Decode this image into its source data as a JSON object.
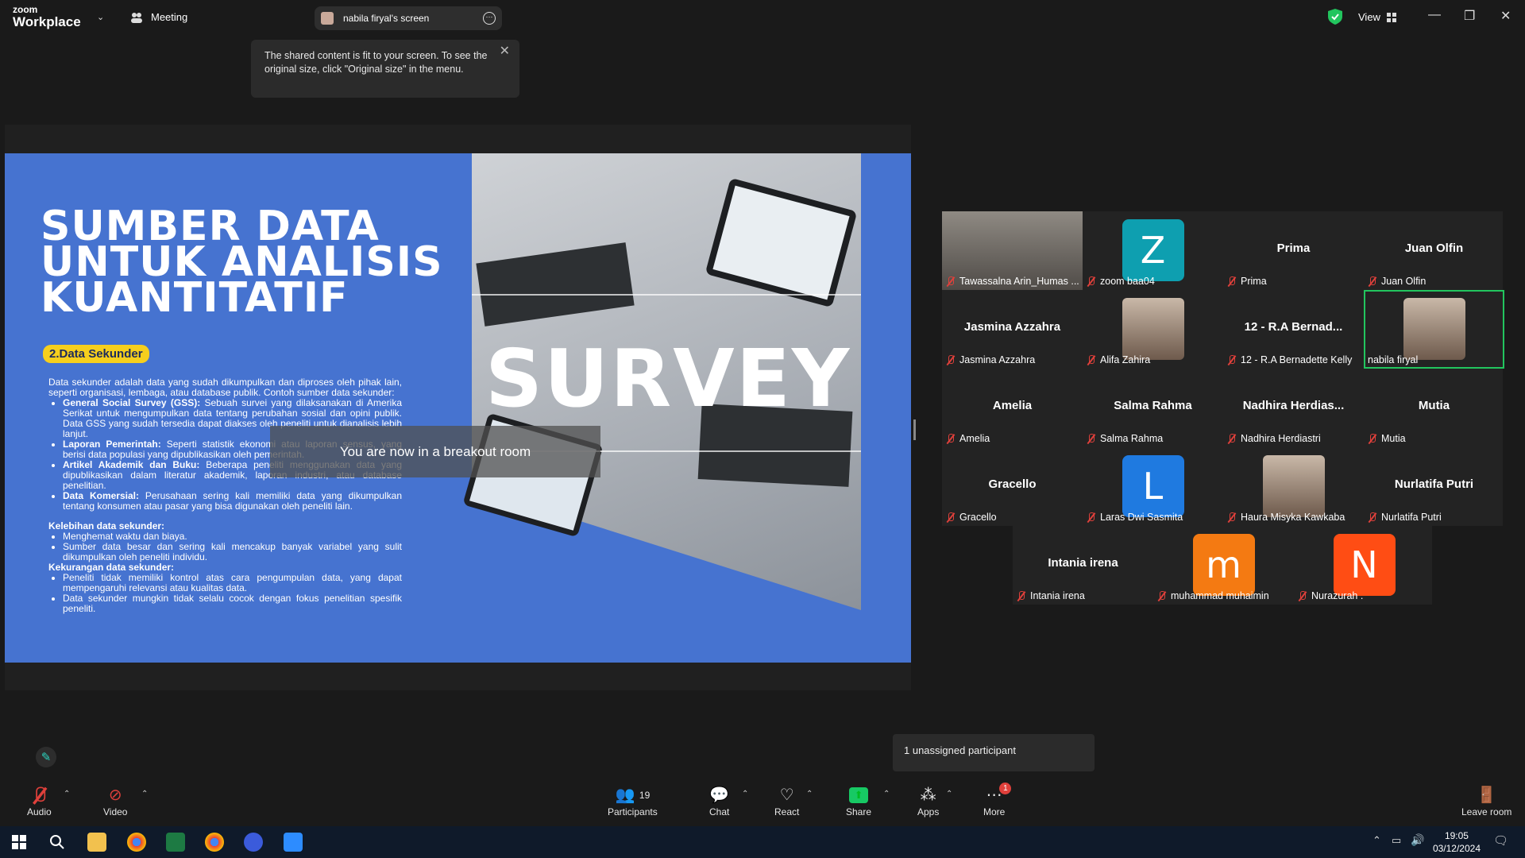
{
  "app": {
    "brand_top": "zoom",
    "brand_bottom": "Workplace",
    "meeting_label": "Meeting",
    "screen_owner": "nabila firyal's screen",
    "view_label": "View"
  },
  "tooltip": {
    "text": "The shared content is fit to your screen. To see the original size, click \"Original size\" in the menu."
  },
  "slide": {
    "title_lines": [
      "SUMBER DATA",
      "UNTUK ANALISIS",
      "KUANTITATIF"
    ],
    "badge": "2.Data Sekunder",
    "intro": "Data sekunder adalah data yang sudah dikumpulkan dan diproses oleh pihak lain, seperti organisasi, lembaga, atau database publik. Contoh sumber data sekunder:",
    "bullets": [
      {
        "bold": "General Social Survey (GSS):",
        "text": " Sebuah survei yang dilaksanakan di Amerika Serikat untuk mengumpulkan data tentang perubahan sosial dan opini publik. Data GSS yang sudah tersedia dapat diakses oleh peneliti untuk dianalisis lebih lanjut."
      },
      {
        "bold": "Laporan Pemerintah:",
        "text": " Seperti statistik ekonomi atau laporan sensus, yang berisi data populasi yang dipublikasikan oleh pemerintah."
      },
      {
        "bold": "Artikel Akademik dan Buku:",
        "text": " Beberapa peneliti menggunakan data yang dipublikasikan dalam literatur akademik, laporan industri, atau database penelitian."
      },
      {
        "bold": "Data Komersial:",
        "text": " Perusahaan sering kali memiliki data yang dikumpulkan tentang konsumen atau pasar yang bisa digunakan oleh peneliti lain."
      }
    ],
    "pros_title": "Kelebihan data sekunder:",
    "pros": [
      "Menghemat waktu dan biaya.",
      "Sumber data besar dan sering kali mencakup banyak variabel yang sulit dikumpulkan oleh peneliti individu."
    ],
    "cons_title": "Kekurangan data sekunder:",
    "cons": [
      "Peneliti tidak memiliki kontrol atas cara pengumpulan data, yang dapat mempengaruhi relevansi atau kualitas data.",
      "Data sekunder mungkin tidak selalu cocok dengan fokus penelitian spesifik peneliti."
    ],
    "photo_word": "SURVEY"
  },
  "breakout_message": "You are now in a breakout room",
  "participants_tiles": [
    {
      "label": "Tawassalna Arin_Humas ...",
      "type": "photo"
    },
    {
      "label": "zoom baa04",
      "type": "avatar",
      "letter": "Z",
      "color": "#0e9fb0"
    },
    {
      "label": "Prima",
      "name": "Prima",
      "type": "name"
    },
    {
      "label": "Juan Olfin",
      "name": "Juan Olfin",
      "type": "name"
    },
    {
      "label": "Jasmina Azzahra",
      "name": "Jasmina Azzahra",
      "type": "name"
    },
    {
      "label": "Alifa Zahira",
      "type": "photo-sq"
    },
    {
      "label": "12 - R.A Bernadette Kelly",
      "name": "12 - R.A Bernad...",
      "type": "name"
    },
    {
      "label": "nabila firyal",
      "type": "photo-sq",
      "active": true
    },
    {
      "label": "Amelia",
      "name": "Amelia",
      "type": "name"
    },
    {
      "label": "Salma Rahma",
      "name": "Salma Rahma",
      "type": "name"
    },
    {
      "label": "Nadhira Herdiastri",
      "name": "Nadhira  Herdias...",
      "type": "name"
    },
    {
      "label": "Mutia",
      "name": "Mutia",
      "type": "name"
    },
    {
      "label": "Gracello",
      "name": "Gracello",
      "type": "name"
    },
    {
      "label": "Laras Dwi Sasmita",
      "type": "avatar",
      "letter": "L",
      "color": "#1f7ae0"
    },
    {
      "label": "Haura Misyka Kawkaba",
      "type": "photo-sq"
    },
    {
      "label": "Nurlatifa Putri",
      "name": "Nurlatifa Putri",
      "type": "name"
    },
    {
      "label": "Intania irena",
      "name": "Intania irena",
      "type": "name"
    },
    {
      "label": "muhammad muhaimin",
      "type": "avatar",
      "letter": "m",
      "color": "#f47a12"
    },
    {
      "label": "Nurazurah .",
      "type": "avatar",
      "letter": "N",
      "color": "#ff4d14"
    }
  ],
  "unassigned": "1 unassigned participant",
  "toolbar": {
    "audio": "Audio",
    "video": "Video",
    "participants": "Participants",
    "participants_count": "19",
    "chat": "Chat",
    "react": "React",
    "share": "Share",
    "apps": "Apps",
    "more": "More",
    "more_badge": "1",
    "leave": "Leave room"
  },
  "taskbar": {
    "time": "19:05",
    "date": "03/12/2024"
  },
  "colors": {
    "active_border": "#22c55e",
    "share_green": "#17c964",
    "slide_blue": "#4673d0",
    "badge_yellow": "#f6cf1d"
  }
}
